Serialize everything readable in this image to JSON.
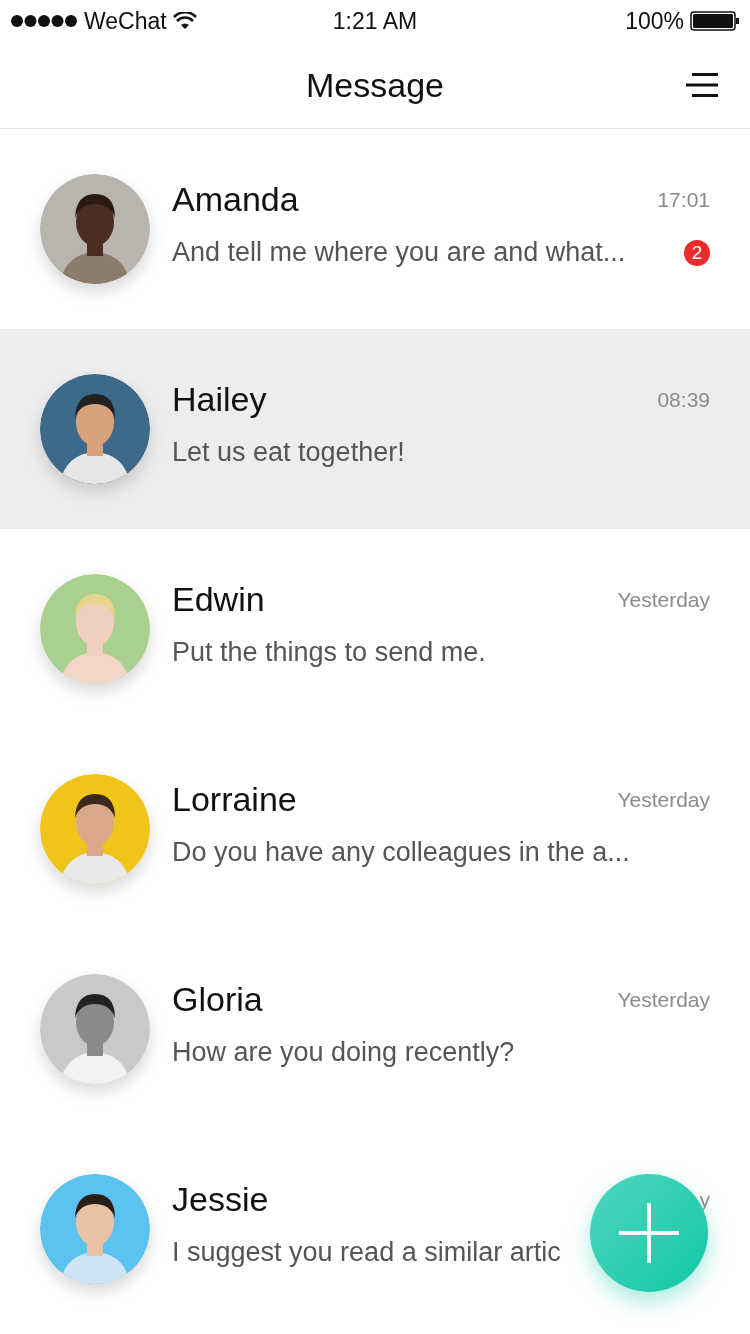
{
  "status_bar": {
    "carrier": "WeChat",
    "time": "1:21 AM",
    "battery": "100%"
  },
  "nav": {
    "title": "Message"
  },
  "chats": [
    {
      "name": "Amanda",
      "time": "17:01",
      "preview": "And tell me where you are and what...",
      "badge": "2",
      "selected": false
    },
    {
      "name": "Hailey",
      "time": "08:39",
      "preview": "Let us eat together!",
      "selected": true
    },
    {
      "name": "Edwin",
      "time": "Yesterday",
      "preview": "Put the things to send me.",
      "selected": false
    },
    {
      "name": "Lorraine",
      "time": "Yesterday",
      "preview": "Do you have any colleagues in the a...",
      "selected": false
    },
    {
      "name": "Gloria",
      "time": "Yesterday",
      "preview": "How are you doing recently?",
      "selected": false
    },
    {
      "name": "Jessie",
      "time": "y",
      "preview": "I suggest you read a similar artic",
      "selected": false
    }
  ]
}
